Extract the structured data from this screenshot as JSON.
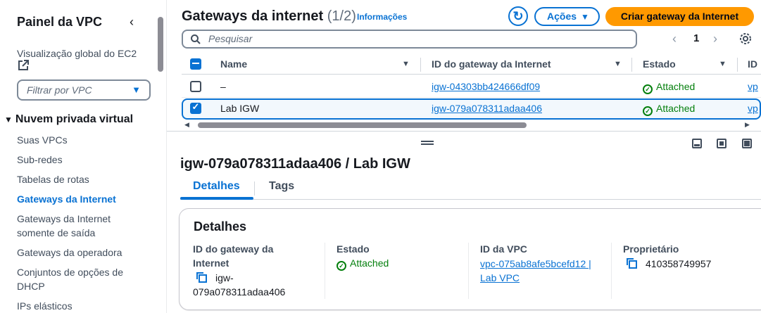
{
  "sidebar": {
    "title": "Painel da VPC",
    "global_view": "Visualização global do EC2",
    "filter_placeholder": "Filtrar por VPC",
    "section": "Nuvem privada virtual",
    "items": [
      {
        "label": "Suas VPCs"
      },
      {
        "label": "Sub-redes"
      },
      {
        "label": "Tabelas de rotas"
      },
      {
        "label": "Gateways da Internet"
      },
      {
        "label": "Gateways da Internet"
      },
      {
        "label": "somente de saída"
      },
      {
        "label": "Gateways da operadora"
      },
      {
        "label": "Conjuntos de opções de"
      },
      {
        "label": "DHCP"
      },
      {
        "label": "IPs elásticos"
      }
    ]
  },
  "header": {
    "title": "Gateways da internet",
    "count": "(1/2)",
    "info": "Informações",
    "refresh_icon": "refresh-icon",
    "actions": "Ações",
    "create": "Criar gateway da Internet"
  },
  "search": {
    "placeholder": "Pesquisar"
  },
  "pagination": {
    "page": "1"
  },
  "table": {
    "columns": [
      "Name",
      "ID do gateway da Internet",
      "Estado",
      "ID"
    ],
    "rows": [
      {
        "name": "–",
        "id": "igw-04303bb424666df09",
        "state": "Attached",
        "vpc": "vp",
        "selected": false
      },
      {
        "name": "Lab IGW",
        "id": "igw-079a078311adaa406",
        "state": "Attached",
        "vpc": "vp",
        "selected": true
      }
    ]
  },
  "detail": {
    "title": "igw-079a078311adaa406 / Lab IGW",
    "tabs": [
      "Detalhes",
      "Tags"
    ],
    "card_title": "Detalhes",
    "fields": {
      "gateway_label_1": "ID do gateway da",
      "gateway_label_2": "Internet",
      "gateway_val_1": "igw-",
      "gateway_val_2": "079a078311adaa406",
      "state_label": "Estado",
      "state_val": "Attached",
      "vpc_label": "ID da VPC",
      "vpc_val_1": "vpc-075ab8afe5bcefd12 |",
      "vpc_val_2": "Lab VPC",
      "owner_label": "Proprietário",
      "owner_val": "410358749957"
    }
  },
  "colors": {
    "accent": "#0972d3",
    "primary": "#ff9900",
    "success": "#037f0c"
  }
}
